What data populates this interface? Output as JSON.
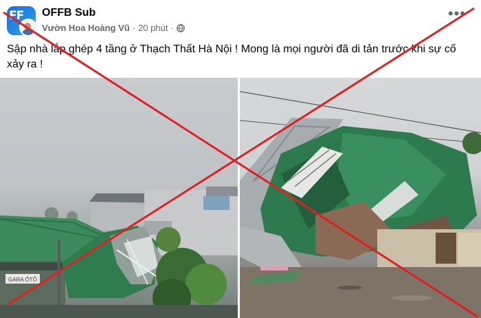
{
  "post": {
    "page_name": "OFFB Sub",
    "author": "Vườn Hoa Hoàng Vũ",
    "separator": "·",
    "time": "20 phút",
    "separator2": "·",
    "more_label": "•••",
    "text": "Sập nhà lắp ghép 4 tầng ở Thạch Thất Hà Nội ! Mong là mọi người đã di tản trước khi sự cố xảy ra !",
    "avatar_letters": "FF"
  },
  "photos": {
    "left": {
      "sign_text": "GARA ÔTÔ"
    }
  },
  "colors": {
    "cross_red": "#e02020",
    "meta_gray": "#65676b",
    "roof_green": "#2f7d4f"
  },
  "icons": [
    "globe-icon",
    "more-options-icon"
  ]
}
